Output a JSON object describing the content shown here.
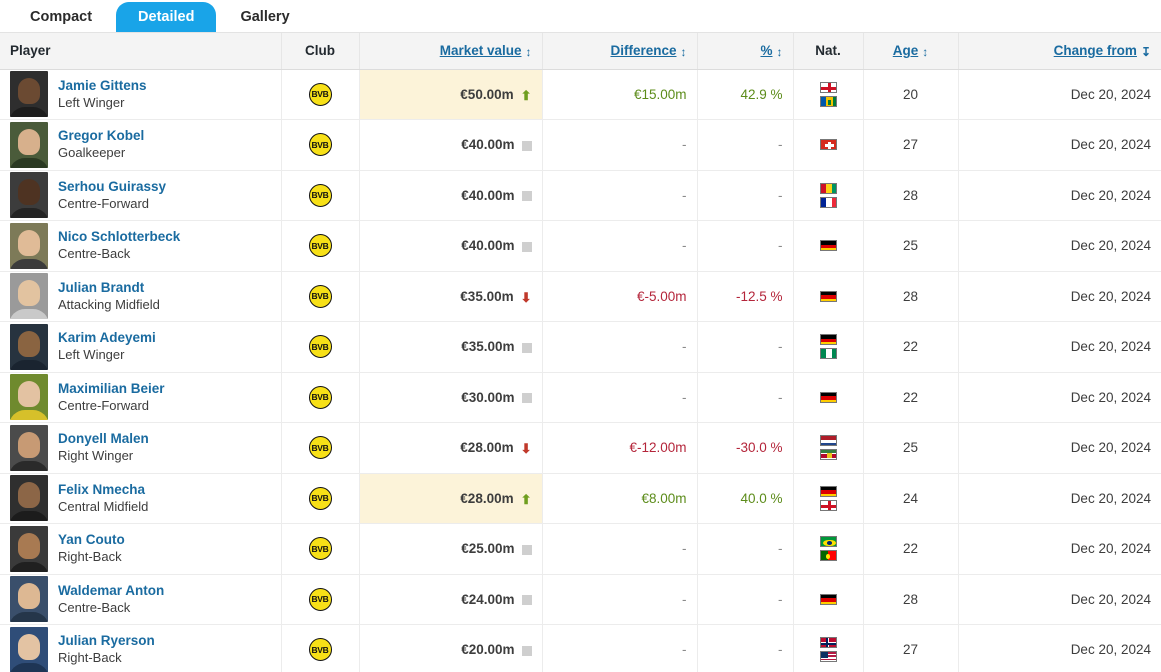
{
  "tabs": [
    {
      "label": "Compact",
      "active": false
    },
    {
      "label": "Detailed",
      "active": true
    },
    {
      "label": "Gallery",
      "active": false
    }
  ],
  "columns": {
    "player": "Player",
    "club": "Club",
    "market_value": "Market value",
    "difference": "Difference",
    "percent": "%",
    "nationality": "Nat.",
    "age": "Age",
    "change_from": "Change from"
  },
  "sort_icons": {
    "market_value": "sort-updown-icon",
    "difference": "sort-updown-icon",
    "percent": "sort-updown-icon",
    "age": "sort-updown-icon",
    "change_from": "sort-desc-icon"
  },
  "colors": {
    "active_tab": "#19a4e8",
    "link": "#1a6ba0",
    "up": "#5c8c1a",
    "down": "#b4253a",
    "highlight_cell": "#fcf3d9",
    "crest_yellow": "#f7e017"
  },
  "club_name": "BVB",
  "rows": [
    {
      "name": "Jamie Gittens",
      "position": "Left Winger",
      "club": "BVB",
      "market_value": "€50.00m",
      "trend": "up",
      "difference": "€15.00m",
      "percent": "42.9 %",
      "nationalities": [
        "England",
        "Saint Vincent and the Grenadines"
      ],
      "age": "20",
      "change_from": "Dec 20, 2024",
      "highlight": true
    },
    {
      "name": "Gregor Kobel",
      "position": "Goalkeeper",
      "club": "BVB",
      "market_value": "€40.00m",
      "trend": "none",
      "difference": "-",
      "percent": "-",
      "nationalities": [
        "Switzerland"
      ],
      "age": "27",
      "change_from": "Dec 20, 2024",
      "highlight": false
    },
    {
      "name": "Serhou Guirassy",
      "position": "Centre-Forward",
      "club": "BVB",
      "market_value": "€40.00m",
      "trend": "none",
      "difference": "-",
      "percent": "-",
      "nationalities": [
        "Guinea",
        "France"
      ],
      "age": "28",
      "change_from": "Dec 20, 2024",
      "highlight": false
    },
    {
      "name": "Nico Schlotterbeck",
      "position": "Centre-Back",
      "club": "BVB",
      "market_value": "€40.00m",
      "trend": "none",
      "difference": "-",
      "percent": "-",
      "nationalities": [
        "Germany"
      ],
      "age": "25",
      "change_from": "Dec 20, 2024",
      "highlight": false
    },
    {
      "name": "Julian Brandt",
      "position": "Attacking Midfield",
      "club": "BVB",
      "market_value": "€35.00m",
      "trend": "down",
      "difference": "€-5.00m",
      "percent": "-12.5 %",
      "nationalities": [
        "Germany"
      ],
      "age": "28",
      "change_from": "Dec 20, 2024",
      "highlight": false
    },
    {
      "name": "Karim Adeyemi",
      "position": "Left Winger",
      "club": "BVB",
      "market_value": "€35.00m",
      "trend": "none",
      "difference": "-",
      "percent": "-",
      "nationalities": [
        "Germany",
        "Nigeria"
      ],
      "age": "22",
      "change_from": "Dec 20, 2024",
      "highlight": false
    },
    {
      "name": "Maximilian Beier",
      "position": "Centre-Forward",
      "club": "BVB",
      "market_value": "€30.00m",
      "trend": "none",
      "difference": "-",
      "percent": "-",
      "nationalities": [
        "Germany"
      ],
      "age": "22",
      "change_from": "Dec 20, 2024",
      "highlight": false
    },
    {
      "name": "Donyell Malen",
      "position": "Right Winger",
      "club": "BVB",
      "market_value": "€28.00m",
      "trend": "down",
      "difference": "€-12.00m",
      "percent": "-30.0 %",
      "nationalities": [
        "Netherlands",
        "Suriname"
      ],
      "age": "25",
      "change_from": "Dec 20, 2024",
      "highlight": false
    },
    {
      "name": "Felix Nmecha",
      "position": "Central Midfield",
      "club": "BVB",
      "market_value": "€28.00m",
      "trend": "up",
      "difference": "€8.00m",
      "percent": "40.0 %",
      "nationalities": [
        "Germany",
        "England"
      ],
      "age": "24",
      "change_from": "Dec 20, 2024",
      "highlight": true
    },
    {
      "name": "Yan Couto",
      "position": "Right-Back",
      "club": "BVB",
      "market_value": "€25.00m",
      "trend": "none",
      "difference": "-",
      "percent": "-",
      "nationalities": [
        "Brazil",
        "Portugal"
      ],
      "age": "22",
      "change_from": "Dec 20, 2024",
      "highlight": false
    },
    {
      "name": "Waldemar Anton",
      "position": "Centre-Back",
      "club": "BVB",
      "market_value": "€24.00m",
      "trend": "none",
      "difference": "-",
      "percent": "-",
      "nationalities": [
        "Germany"
      ],
      "age": "28",
      "change_from": "Dec 20, 2024",
      "highlight": false
    },
    {
      "name": "Julian Ryerson",
      "position": "Right-Back",
      "club": "BVB",
      "market_value": "€20.00m",
      "trend": "none",
      "difference": "-",
      "percent": "-",
      "nationalities": [
        "Norway",
        "United States"
      ],
      "age": "27",
      "change_from": "Dec 20, 2024",
      "highlight": false
    }
  ],
  "photo_palette": [
    {
      "skin": "#6b4a32",
      "bg": "#2e2e2e",
      "shirt": "#1d1d1d"
    },
    {
      "skin": "#d7b08c",
      "bg": "#4a5b3a",
      "shirt": "#2b3a23"
    },
    {
      "skin": "#4e3322",
      "bg": "#3c3c3c",
      "shirt": "#242424"
    },
    {
      "skin": "#e0bb97",
      "bg": "#7d7a58",
      "shirt": "#3b3b3b"
    },
    {
      "skin": "#e2c3a0",
      "bg": "#9a9a9a",
      "shirt": "#c9c9c9"
    },
    {
      "skin": "#8a6441",
      "bg": "#27333f",
      "shirt": "#1a2430"
    },
    {
      "skin": "#e3c2a2",
      "bg": "#6f8a2e",
      "shirt": "#d6c02a"
    },
    {
      "skin": "#c79a74",
      "bg": "#4b4b4b",
      "shirt": "#2a2a2a"
    },
    {
      "skin": "#8c6647",
      "bg": "#2f2f2f",
      "shirt": "#1c1c1c"
    },
    {
      "skin": "#a87a52",
      "bg": "#3a3a3a",
      "shirt": "#202020"
    },
    {
      "skin": "#ddb893",
      "bg": "#3a4f6b",
      "shirt": "#25364a"
    },
    {
      "skin": "#e3c3a3",
      "bg": "#2f4d78",
      "shirt": "#1e3555"
    }
  ]
}
